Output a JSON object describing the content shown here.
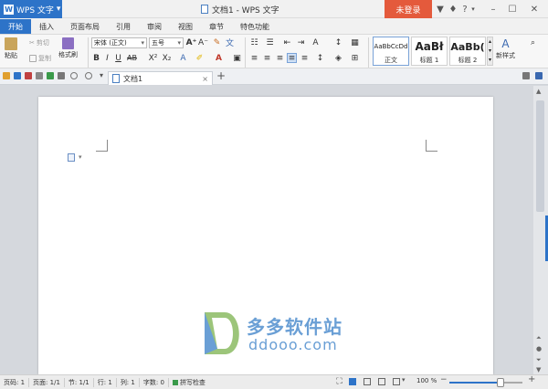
{
  "app": {
    "name": "WPS 文字",
    "title": "文档1 - WPS 文字",
    "login": "未登录",
    "help": "?"
  },
  "tabs": [
    "开始",
    "插入",
    "页面布局",
    "引用",
    "审阅",
    "视图",
    "章节",
    "特色功能"
  ],
  "ribbon": {
    "paste": "粘贴",
    "cut": "剪切",
    "copy": "复制",
    "format_painter": "格式刷",
    "font_name": "宋体 (正文)",
    "font_size": "五号",
    "new_style": "新样式",
    "styles": [
      {
        "preview": "AaBbCcDd",
        "label": "正文"
      },
      {
        "preview": "AaBł",
        "label": "标题 1"
      },
      {
        "preview": "AaBb(",
        "label": "标题 2"
      }
    ]
  },
  "doc_tab": {
    "name": "文档1",
    "add": "+"
  },
  "status": {
    "page": "页码: 1",
    "pages": "页面: 1/1",
    "section": "节: 1/1",
    "row": "行: 1",
    "col": "列: 1",
    "words": "字数: 0",
    "spell": "拼写检查",
    "zoom": "100 %",
    "zoom_level": 0.7
  },
  "watermark": {
    "name": "多多软件站",
    "url": "ddooo.com"
  },
  "colors": {
    "accent": "#2d73c8",
    "login": "#e45a3c"
  }
}
